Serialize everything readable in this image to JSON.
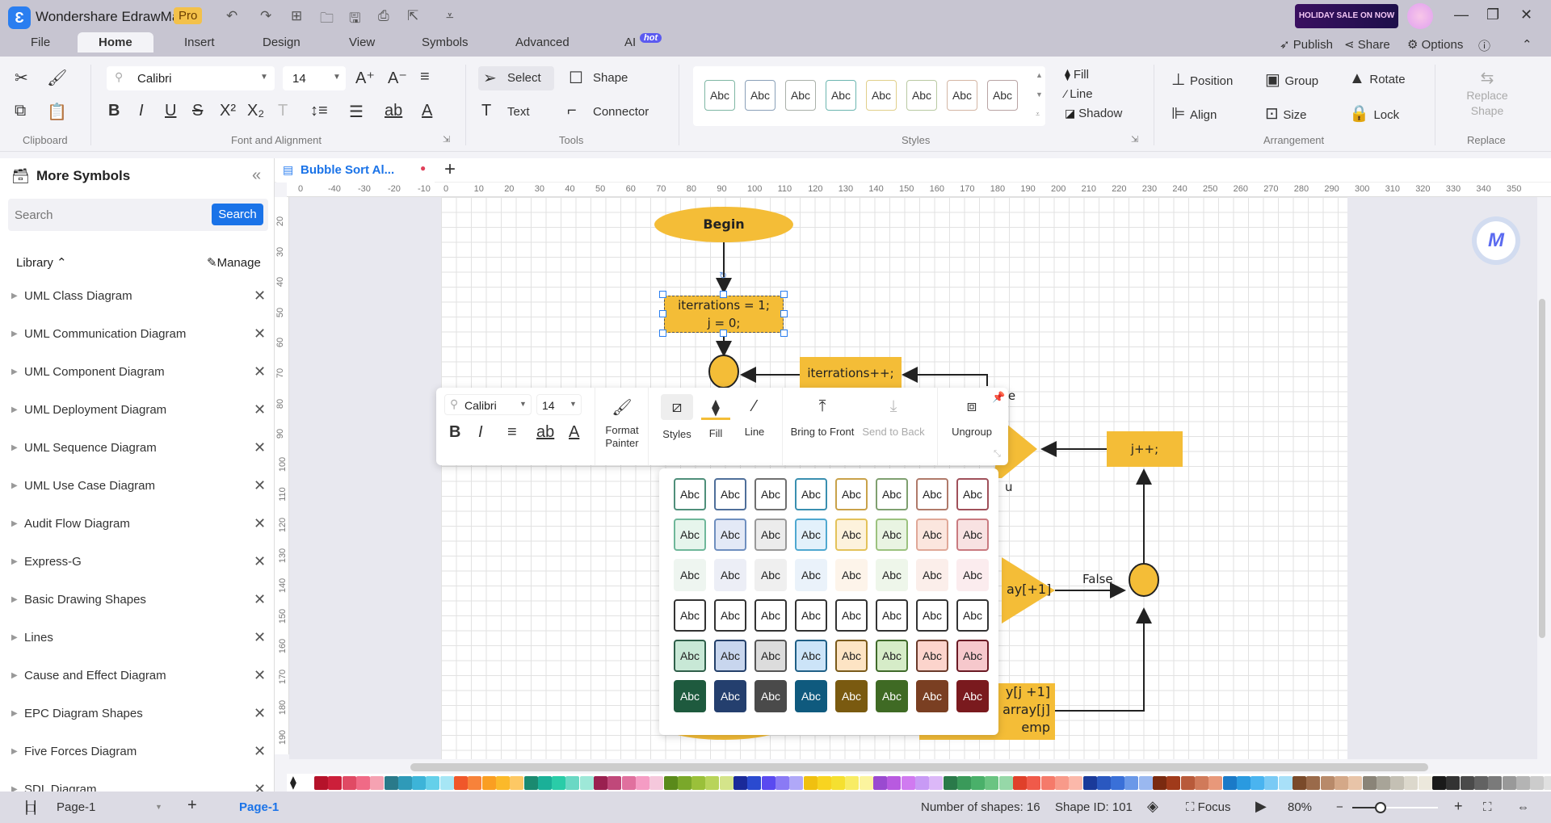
{
  "app": {
    "title": "Wondershare EdrawMax",
    "badge": "Pro",
    "sale": "HOLIDAY SALE ON NOW"
  },
  "menu_tabs": [
    {
      "label": "File"
    },
    {
      "label": "Home",
      "active": true
    },
    {
      "label": "Insert"
    },
    {
      "label": "Design"
    },
    {
      "label": "View"
    },
    {
      "label": "Symbols"
    },
    {
      "label": "Advanced"
    },
    {
      "label": "AI",
      "badge": "hot"
    }
  ],
  "top_actions": {
    "publish": "Publish",
    "share": "Share",
    "options": "Options"
  },
  "ribbon": {
    "groups": {
      "clipboard": "Clipboard",
      "font": "Font and Alignment",
      "tools": "Tools",
      "styles": "Styles",
      "arrangement": "Arrangement",
      "replace": "Replace"
    },
    "font_name": "Calibri",
    "font_size": "14",
    "tools": {
      "select": "Select",
      "shape": "Shape",
      "text": "Text",
      "connector": "Connector"
    },
    "style_swatch": "Abc",
    "style_borders": [
      "#7fb7a4",
      "#8aa0b8",
      "#a9b0a9",
      "#6cb6b0",
      "#e0cf8a",
      "#b9c9a2",
      "#d4b6a4",
      "#b8a3a3"
    ],
    "fill": "Fill",
    "line": "Line",
    "shadow": "Shadow",
    "position": "Position",
    "group": "Group",
    "rotate": "Rotate",
    "align": "Align",
    "size": "Size",
    "lock": "Lock",
    "replace_shape": "Replace Shape"
  },
  "sidebar": {
    "title": "More Symbols",
    "search_placeholder": "Search",
    "search_button": "Search",
    "library": "Library",
    "manage": "Manage",
    "items": [
      {
        "label": "UML Class Diagram"
      },
      {
        "label": "UML Communication Diagram"
      },
      {
        "label": "UML Component Diagram"
      },
      {
        "label": "UML Deployment Diagram"
      },
      {
        "label": "UML Sequence Diagram"
      },
      {
        "label": "UML Use Case Diagram"
      },
      {
        "label": "Audit Flow Diagram"
      },
      {
        "label": "Express-G"
      },
      {
        "label": "Basic Drawing Shapes"
      },
      {
        "label": "Lines"
      },
      {
        "label": "Cause and Effect Diagram"
      },
      {
        "label": "EPC Diagram Shapes"
      },
      {
        "label": "Five Forces Diagram"
      },
      {
        "label": "SDL Diagram"
      }
    ]
  },
  "document": {
    "tab": "Bubble Sort Al..."
  },
  "rulers": {
    "h": [
      "0",
      "-40",
      "-30",
      "-20",
      "-10",
      "0",
      "10",
      "20",
      "30",
      "40",
      "50",
      "60",
      "70",
      "80",
      "90",
      "100",
      "110",
      "120",
      "130",
      "140",
      "150",
      "160",
      "170",
      "180",
      "190",
      "200",
      "210",
      "220",
      "230",
      "240",
      "250",
      "260",
      "270",
      "280",
      "290",
      "300",
      "310",
      "320",
      "330",
      "340",
      "350"
    ],
    "v": [
      "20",
      "30",
      "40",
      "50",
      "60",
      "70",
      "80",
      "90",
      "100",
      "110",
      "120",
      "130",
      "140",
      "150",
      "160",
      "170",
      "180",
      "190"
    ]
  },
  "diagram": {
    "begin": "Begin",
    "init_1": "iterrations = 1;",
    "init_2": "j = 0;",
    "iter_inc": "iterrations++;",
    "j_inc": "j++;",
    "false_label": "False",
    "cond_frag": "ay[+1]",
    "se_frag": "se",
    "u_frag": "u",
    "swap_1": "y[j +1]",
    "swap_2": "array[j]",
    "swap_3": "emp"
  },
  "float_toolbar": {
    "font": "Calibri",
    "size": "14",
    "format_painter": "Format Painter",
    "styles": "Styles",
    "fill": "Fill",
    "line": "Line",
    "bring_front": "Bring to Front",
    "send_back": "Send to Back",
    "ungroup": "Ungroup"
  },
  "style_grid": {
    "label": "Abc",
    "rows": [
      {
        "fill": [
          "#ffffff",
          "#ffffff",
          "#ffffff",
          "#ffffff",
          "#ffffff",
          "#ffffff",
          "#ffffff",
          "#ffffff"
        ],
        "border": [
          "#4f8f7a",
          "#4f6f9a",
          "#707070",
          "#3a8fb0",
          "#c9a24a",
          "#7fa070",
          "#b07a6a",
          "#a0505a"
        ],
        "text": "#222"
      },
      {
        "fill": [
          "#e6f5ec",
          "#e3e9f6",
          "#ececec",
          "#e3f1fb",
          "#fdf2dc",
          "#e9f4e2",
          "#fbe6de",
          "#f8e2e2"
        ],
        "border": [
          "#6fb79a",
          "#6f8fbf",
          "#999",
          "#4fa8d0",
          "#e3c25a",
          "#9cc27f",
          "#e0a898",
          "#c97a80"
        ],
        "text": "#222"
      },
      {
        "fill": [
          "#eef5f0",
          "#eceef6",
          "#efefef",
          "#eaf2fa",
          "#fdf4ea",
          "#eef6ea",
          "#fbeeea",
          "#fbecee"
        ],
        "border": [
          "#eef5f0",
          "#eceef6",
          "#efefef",
          "#eaf2fa",
          "#fdf4ea",
          "#eef6ea",
          "#fbeeea",
          "#fbecee"
        ],
        "text": "#222"
      },
      {
        "fill": [
          "#ffffff",
          "#ffffff",
          "#ffffff",
          "#ffffff",
          "#ffffff",
          "#ffffff",
          "#ffffff",
          "#ffffff"
        ],
        "border": [
          "#333",
          "#333",
          "#333",
          "#333",
          "#333",
          "#333",
          "#333",
          "#333"
        ],
        "text": "#222"
      },
      {
        "fill": [
          "#c8e8d6",
          "#c8d6ee",
          "#dcdcdc",
          "#cce4f8",
          "#fde4c4",
          "#d6ecc8",
          "#fcd4cc",
          "#f6c8cc"
        ],
        "border": [
          "#2f5f4a",
          "#24406a",
          "#555",
          "#1f5f86",
          "#7a5a1a",
          "#3f6a2a",
          "#6a3a2a",
          "#6a1a24"
        ],
        "text": "#222"
      },
      {
        "fill": [
          "#1e5a3e",
          "#243f6e",
          "#4a4a4a",
          "#0f5a7e",
          "#7a5a10",
          "#3f6a24",
          "#7a3f22",
          "#7a1a1e"
        ],
        "border": [
          "#1e5a3e",
          "#243f6e",
          "#4a4a4a",
          "#0f5a7e",
          "#7a5a10",
          "#3f6a24",
          "#7a3f22",
          "#7a1a1e"
        ],
        "text": "#ffffff"
      }
    ]
  },
  "palette": [
    "#b5122a",
    "#cc1f3a",
    "#e04a64",
    "#f06a86",
    "#f5a2b2",
    "#2a7a8a",
    "#2f9ab8",
    "#3db4d8",
    "#64d0ea",
    "#a6e6f5",
    "#f0572a",
    "#f7823a",
    "#fa9e22",
    "#fbb92a",
    "#fdc864",
    "#1a8a70",
    "#1ab098",
    "#2acca8",
    "#6ad8c4",
    "#9ee8d8",
    "#9a2050",
    "#c0487a",
    "#e0709e",
    "#f59cc4",
    "#f5c8dc",
    "#5a8a1a",
    "#7aa82a",
    "#9ac03a",
    "#b8d45a",
    "#d4e48a",
    "#1a2a9a",
    "#2a4ad0",
    "#5a4af0",
    "#8a7af5",
    "#b0a8f8",
    "#f0c010",
    "#f8d420",
    "#f5e030",
    "#f8ec64",
    "#fbf49e",
    "#9a4ad0",
    "#b85ae0",
    "#d07af0",
    "#c89af5",
    "#dcb8f8",
    "#2a7a4a",
    "#3a9a5a",
    "#4ab06a",
    "#6ac482",
    "#96d8a8",
    "#e0402a",
    "#f05a4a",
    "#f57a6a",
    "#f89a8a",
    "#fbb8aa",
    "#1a3a9a",
    "#2a58c0",
    "#3a70d8",
    "#6a98e8",
    "#9ab8f0",
    "#7a2a10",
    "#a03a1a",
    "#b85a3a",
    "#d07a5a",
    "#e8987a",
    "#1a7ac8",
    "#2a9ae0",
    "#4ab4f0",
    "#7acaf5",
    "#a8e0f8",
    "#7a4a2a",
    "#9a6a4a",
    "#b88a6a",
    "#d4a888",
    "#e8c4a8",
    "#8a8478",
    "#a8a498",
    "#c4c0b4",
    "#dcd8cc",
    "#ece8dc",
    "#1a1a1a",
    "#333333",
    "#4a4a4a",
    "#626262",
    "#7a7a7a",
    "#999999",
    "#b4b4b4",
    "#cccccc",
    "#e0e0e0",
    "#f4f4f4"
  ],
  "status": {
    "page_select": "Page-1",
    "page_tab": "Page-1",
    "shapes": "Number of shapes: 16",
    "shape_id": "Shape ID: 101",
    "focus": "Focus",
    "zoom": "80%",
    "zoom_value": 0.8
  },
  "colors": {
    "accent": "#1a73e8",
    "node_fill": "#f4bd37"
  }
}
